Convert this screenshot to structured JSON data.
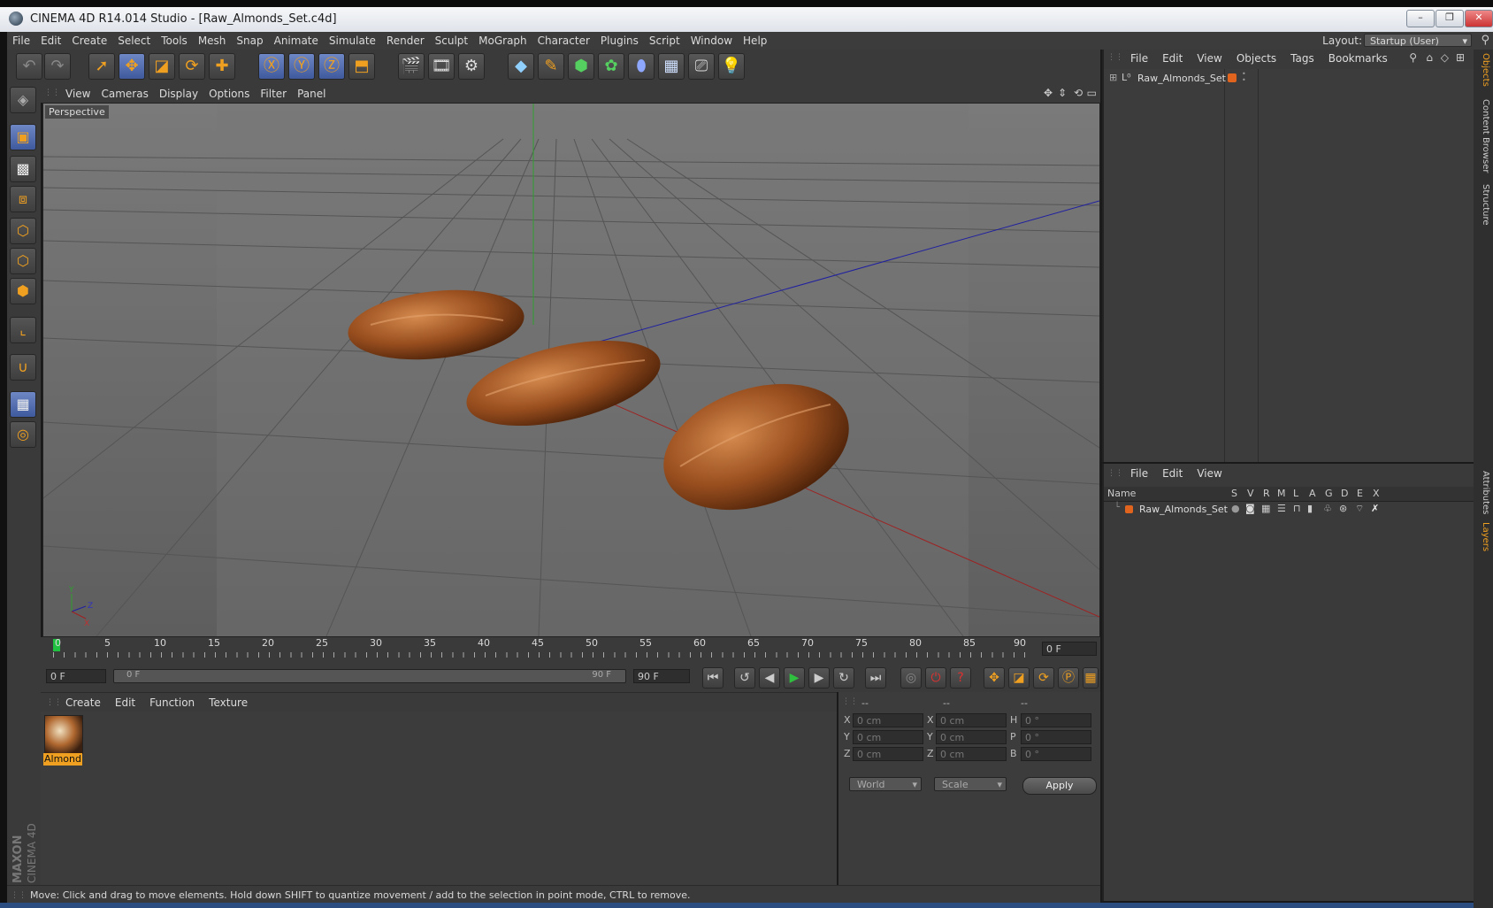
{
  "window": {
    "title": "CINEMA 4D R14.014 Studio - [Raw_Almonds_Set.c4d]",
    "controls": {
      "minimize": "–",
      "maximize": "❐",
      "close": "✕"
    }
  },
  "menubar": {
    "items": [
      "File",
      "Edit",
      "Create",
      "Select",
      "Tools",
      "Mesh",
      "Snap",
      "Animate",
      "Simulate",
      "Render",
      "Sculpt",
      "MoGraph",
      "Character",
      "Plugins",
      "Script",
      "Window",
      "Help"
    ],
    "layout_label": "Layout:",
    "layout_value": "Startup (User)"
  },
  "viewport": {
    "menu": [
      "View",
      "Cameras",
      "Display",
      "Options",
      "Filter",
      "Panel"
    ],
    "label": "Perspective",
    "axis_labels": {
      "x": "X",
      "y": "Y",
      "z": "Z"
    }
  },
  "timeline": {
    "ticks": [
      "0",
      "5",
      "10",
      "15",
      "20",
      "25",
      "30",
      "35",
      "40",
      "45",
      "50",
      "55",
      "60",
      "65",
      "70",
      "75",
      "80",
      "85",
      "90"
    ],
    "current_frame": "0 F"
  },
  "transport": {
    "start_field": "0 F",
    "range_start": "0 F",
    "range_end": "90 F",
    "end_field": "90 F"
  },
  "materials": {
    "menu": [
      "Create",
      "Edit",
      "Function",
      "Texture"
    ],
    "items": [
      {
        "name": "Almond"
      }
    ]
  },
  "coordinates": {
    "headers": [
      "--",
      "--",
      "--"
    ],
    "rows": [
      {
        "a": "X",
        "a_val": "0 cm",
        "b": "X",
        "b_val": "0 cm",
        "c": "H",
        "c_val": "0 °"
      },
      {
        "a": "Y",
        "a_val": "0 cm",
        "b": "Y",
        "b_val": "0 cm",
        "c": "P",
        "c_val": "0 °"
      },
      {
        "a": "Z",
        "a_val": "0 cm",
        "b": "Z",
        "b_val": "0 cm",
        "c": "B",
        "c_val": "0 °"
      }
    ],
    "mode_select": "World",
    "scale_select": "Scale",
    "apply_label": "Apply"
  },
  "objects": {
    "menu": [
      "File",
      "Edit",
      "View",
      "Objects",
      "Tags",
      "Bookmarks"
    ],
    "tree": [
      {
        "name": "Raw_Almonds_Set"
      }
    ]
  },
  "layers": {
    "menu": [
      "File",
      "Edit",
      "View"
    ],
    "columns": [
      "Name",
      "S",
      "V",
      "R",
      "M",
      "L",
      "A",
      "G",
      "D",
      "E",
      "X"
    ],
    "rows": [
      {
        "name": "Raw_Almonds_Set"
      }
    ]
  },
  "right_tabs": [
    "Objects",
    "Content Browser",
    "Structure",
    "Attributes",
    "Layers"
  ],
  "status": "Move: Click and drag to move elements. Hold down SHIFT to quantize movement / add to the selection in point mode, CTRL to remove.",
  "branding": {
    "maxon": "MAXON",
    "product": "CINEMA 4D"
  },
  "colors": {
    "accent": "#f0a020",
    "active_tool": "#4f6bb0",
    "viewport_bg": "#6c6c6c",
    "layer_color": "#e0641e"
  }
}
